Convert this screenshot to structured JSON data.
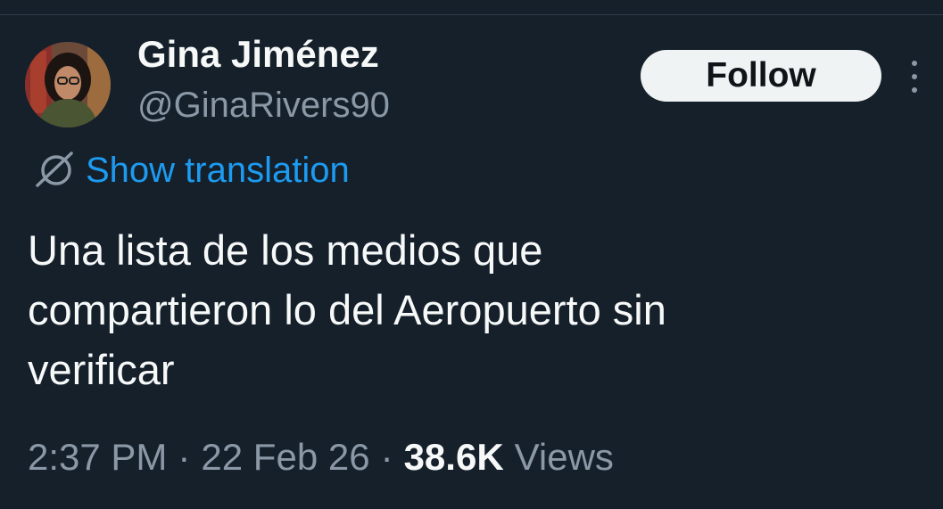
{
  "tweet": {
    "author": {
      "display_name": "Gina Jiménez",
      "handle": "@GinaRivers90",
      "avatar": "profile-photo"
    },
    "follow_label": "Follow",
    "more_icon": "more-vertical-icon",
    "translation": {
      "icon": "globe-translate-icon",
      "label": "Show translation"
    },
    "text": "Una lista de los medios que\ncompartieron lo del Aeropuerto sin\nverificar",
    "meta": {
      "time": "2:37 PM",
      "separator": "·",
      "date": "22 Feb 26",
      "views_count": "38.6K",
      "views_label": "Views"
    }
  },
  "colors": {
    "background": "#15202b",
    "primary_text": "#f7f9f9",
    "secondary_text": "#8b98a5",
    "link": "#1d9bf0",
    "follow_button_bg": "#eff3f4",
    "follow_button_text": "#0f1419"
  }
}
